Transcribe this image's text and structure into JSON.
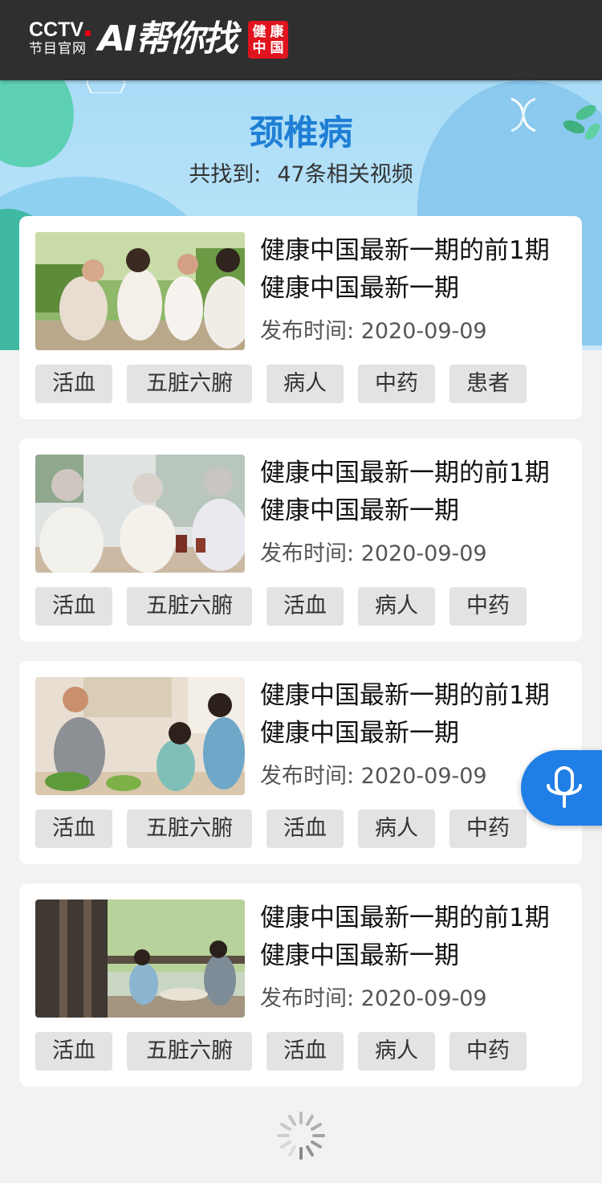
{
  "header": {
    "cctv_text": "CCTV",
    "cctv_sub": "节目官网",
    "app_name": "AI帮你找",
    "seal_chars": [
      "健",
      "康",
      "中",
      "国"
    ]
  },
  "search": {
    "keyword": "颈椎病",
    "count_prefix": "共找到:",
    "count_text": "47条相关视频"
  },
  "results": [
    {
      "title": "健康中国最新一期的前1期健康中国最新一期",
      "date": "发布时间:  2020-09-09",
      "tags": [
        "活血",
        "五脏六腑",
        "病人",
        "中药",
        "患者"
      ],
      "image": "family-outdoor-photo"
    },
    {
      "title": "健康中国最新一期的前1期健康中国最新一期",
      "date": "发布时间:  2020-09-09",
      "tags": [
        "活血",
        "五脏六腑",
        "活血",
        "病人",
        "中药"
      ],
      "image": "elderly-dining-photo"
    },
    {
      "title": "健康中国最新一期的前1期健康中国最新一期",
      "date": "发布时间:  2020-09-09",
      "tags": [
        "活血",
        "五脏六腑",
        "活血",
        "病人",
        "中药"
      ],
      "image": "family-kitchen-photo"
    },
    {
      "title": "健康中国最新一期的前1期健康中国最新一期",
      "date": "发布时间:  2020-09-09",
      "tags": [
        "活血",
        "五脏六腑",
        "活血",
        "病人",
        "中药"
      ],
      "image": "family-balcony-photo"
    }
  ],
  "colors": {
    "accent": "#1f7fe6",
    "title_blue": "#1f7fd6",
    "topbar": "#2f2f2f",
    "seal_red": "#e0141e"
  },
  "icons": {
    "mic": "microphone-icon",
    "loading": "loading-spinner-icon"
  }
}
